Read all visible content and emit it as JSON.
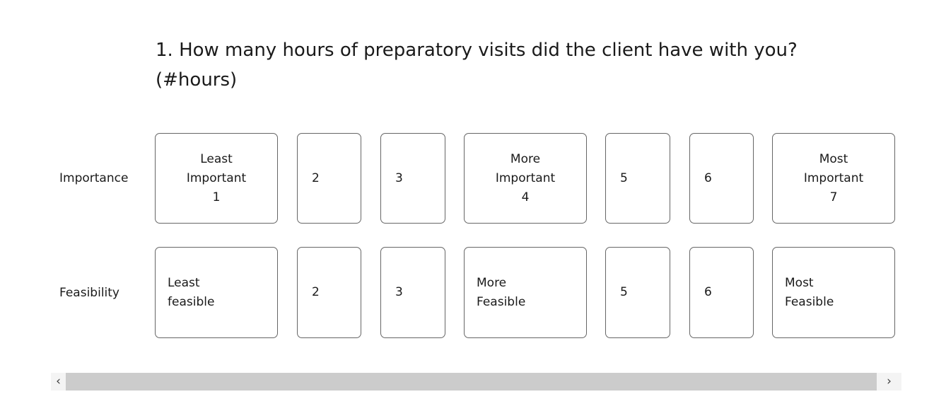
{
  "question": {
    "title": "1. How many hours of preparatory visits did the client have with you? (#hours)"
  },
  "matrix": {
    "rows": [
      {
        "label": "Importance",
        "cells": [
          {
            "text": "Least\nImportant\n1",
            "size": "wide"
          },
          {
            "text": "2",
            "size": "narrow"
          },
          {
            "text": "3",
            "size": "narrow"
          },
          {
            "text": "More\nImportant\n4",
            "size": "wide"
          },
          {
            "text": "5",
            "size": "narrow"
          },
          {
            "text": "6",
            "size": "narrow"
          },
          {
            "text": "Most\nImportant\n7",
            "size": "wide"
          }
        ]
      },
      {
        "label": "Feasibility",
        "cells": [
          {
            "text": "Least\nfeasible",
            "size": "wide"
          },
          {
            "text": "2",
            "size": "narrow"
          },
          {
            "text": "3",
            "size": "narrow"
          },
          {
            "text": "More\nFeasible",
            "size": "wide"
          },
          {
            "text": "5",
            "size": "narrow"
          },
          {
            "text": "6",
            "size": "narrow"
          },
          {
            "text": "Most\nFeasible",
            "size": "wide"
          }
        ]
      }
    ]
  },
  "scrollbar": {
    "left_arrow": "‹",
    "right_arrow": "›"
  },
  "colors": {
    "cell_border": "#666666",
    "text": "#1a1a1a",
    "scroll_thumb": "#cccccc",
    "scroll_arrow_bg": "#f4f4f4"
  }
}
